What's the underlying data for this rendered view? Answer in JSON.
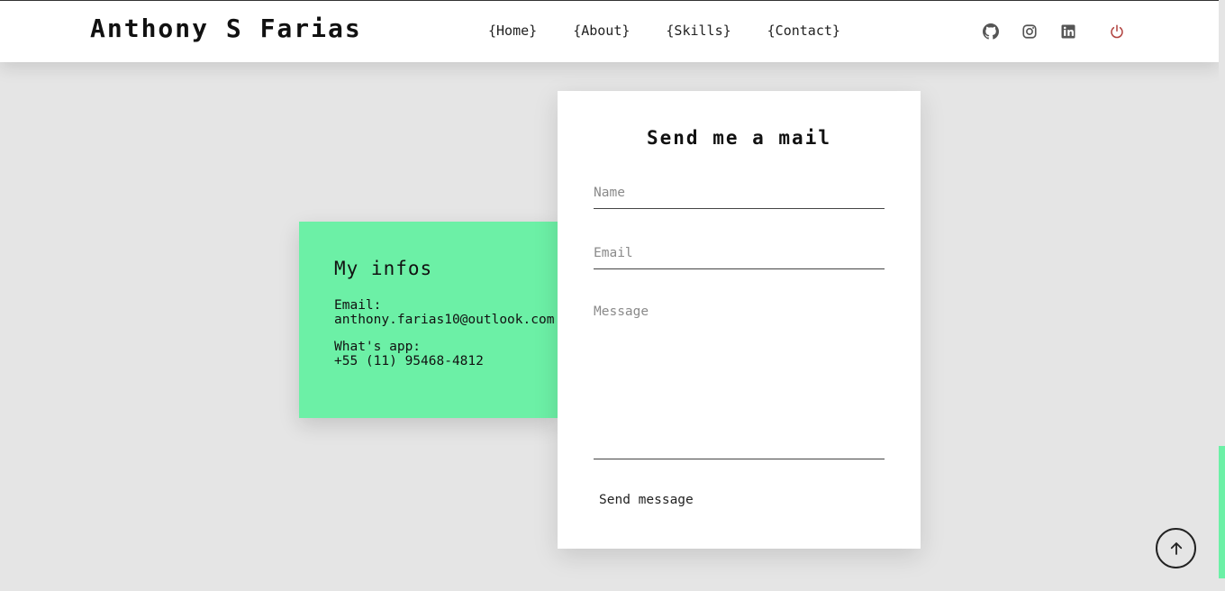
{
  "header": {
    "brand": "Anthony S Farias",
    "nav": [
      "{Home}",
      "{About}",
      "{Skills}",
      "{Contact}"
    ],
    "social_icons": [
      "github-icon",
      "instagram-icon",
      "linkedin-icon",
      "power-icon"
    ]
  },
  "infos": {
    "title": "My infos",
    "email_label": "Email:",
    "email_value": "anthony.farias10@outlook.com",
    "whatsapp_label": "What's app:",
    "whatsapp_value": "+55 (11) 95468-4812"
  },
  "form": {
    "title": "Send me a mail",
    "name_placeholder": "Name",
    "email_placeholder": "Email",
    "message_placeholder": "Message",
    "send_label": "Send message"
  },
  "colors": {
    "accent": "#6cf0a6",
    "power": "#b0413e",
    "background": "#e5e5e5"
  }
}
